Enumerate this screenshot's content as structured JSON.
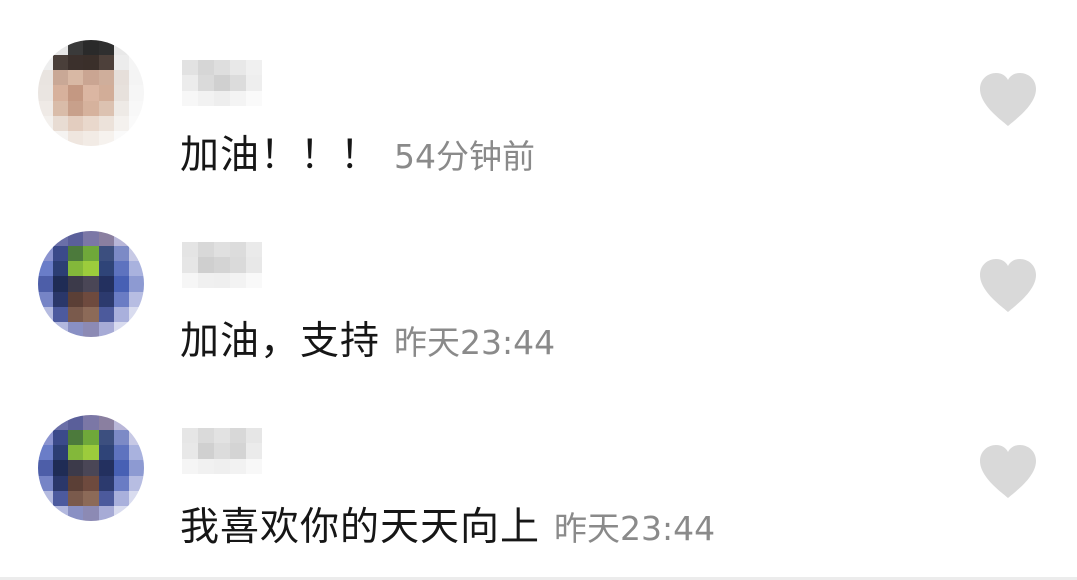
{
  "comments": [
    {
      "text": "加油！！！",
      "time": "54分钟前",
      "username": "",
      "avatar": "avatar-face"
    },
    {
      "text": "加油，支持",
      "time": "昨天23:44",
      "username": "",
      "avatar": "avatar-cartoon"
    },
    {
      "text": "我喜欢你的天天向上",
      "time": "昨天23:44",
      "username": "",
      "avatar": "avatar-cartoon"
    }
  ],
  "icons": {
    "like": "heart-icon"
  },
  "colors": {
    "text": "#161616",
    "timestamp": "#8a8a8a",
    "like_icon": "#d9d9d9",
    "background": "#ffffff"
  }
}
